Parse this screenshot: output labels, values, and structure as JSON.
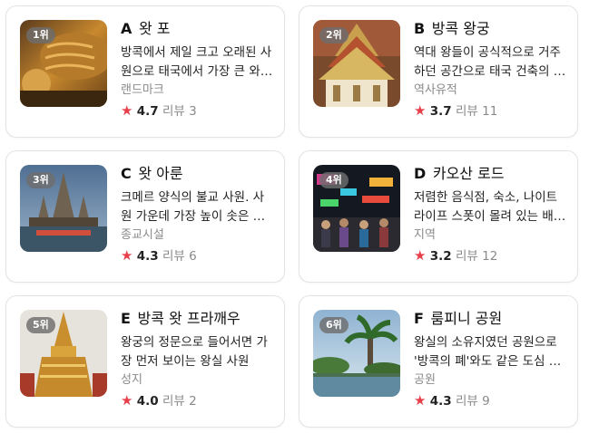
{
  "places": [
    {
      "rank": "1위",
      "letter": "A",
      "name": "왓 포",
      "desc": "방콕에서 제일 크고 오래된 사원으로 태국에서 가장 큰 와불이 있는 곳",
      "category": "랜드마크",
      "rating": "4.7",
      "review_label": "리뷰",
      "review_count": "3",
      "icon": "reclining-buddha-photo"
    },
    {
      "rank": "2위",
      "letter": "B",
      "name": "방콕 왕궁",
      "desc": "역대 왕들이 공식적으로 거주하던 공간으로 태국 건축의 정수를 볼 수 있는 곳",
      "category": "역사유적",
      "rating": "3.7",
      "review_label": "리뷰",
      "review_count": "11",
      "icon": "grand-palace-photo"
    },
    {
      "rank": "3위",
      "letter": "C",
      "name": "왓 아룬",
      "desc": "크메르 양식의 불교 사원. 사원 가운데 가장 높이 솟은 탑이 인상적인 곳",
      "category": "종교시설",
      "rating": "4.3",
      "review_label": "리뷰",
      "review_count": "6",
      "icon": "wat-arun-photo"
    },
    {
      "rank": "4위",
      "letter": "D",
      "name": "카오산 로드",
      "desc": "저렴한 음식점, 숙소, 나이트라이프 스폿이 몰려 있는 배낭여행자의 거리",
      "category": "지역",
      "rating": "3.2",
      "review_label": "리뷰",
      "review_count": "12",
      "icon": "khaosan-road-photo"
    },
    {
      "rank": "5위",
      "letter": "E",
      "name": "방콕 왓 프라깨우",
      "desc": "왕궁의 정문으로 들어서면 가장 먼저 보이는 왕실 사원",
      "category": "성지",
      "rating": "4.0",
      "review_label": "리뷰",
      "review_count": "2",
      "icon": "golden-chedi-photo"
    },
    {
      "rank": "6위",
      "letter": "F",
      "name": "룸피니 공원",
      "desc": "왕실의 소유지였던 공원으로 '방콕의 폐'와도 같은 도심 속 녹지",
      "category": "공원",
      "rating": "4.3",
      "review_label": "리뷰",
      "review_count": "9",
      "icon": "lumphini-park-photo"
    }
  ],
  "colors": {
    "star": "#e8404a",
    "muted": "#8a8a8a",
    "border": "#e3e3e3"
  }
}
